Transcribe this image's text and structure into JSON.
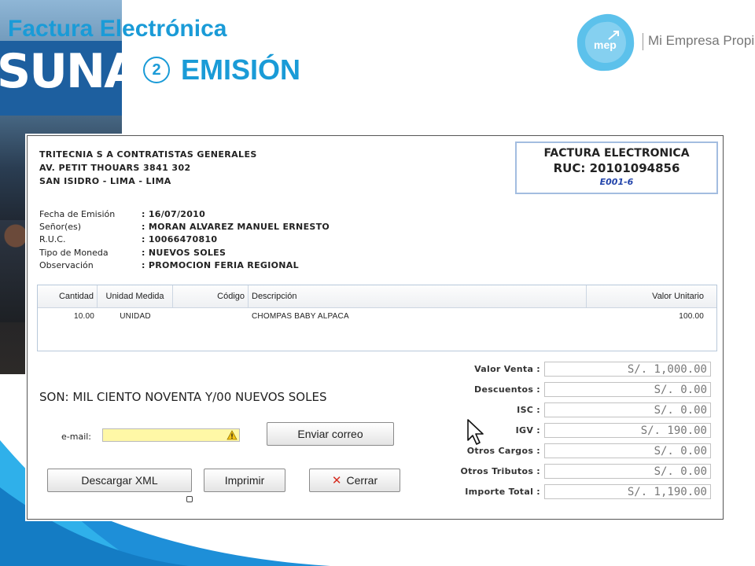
{
  "slide": {
    "title": "Factura Electrónica",
    "step_number": "2",
    "subtitle": "EMISIÓN",
    "photo_sign": "SUNAT"
  },
  "logo": {
    "brand": "mep",
    "text": "Mi Empresa Propia"
  },
  "invoice": {
    "company": {
      "name": "TRITECNIA S A CONTRATISTAS GENERALES",
      "address": "AV. PETIT THOUARS 3841 302",
      "district": "SAN ISIDRO - LIMA - LIMA"
    },
    "ruc_box": {
      "title": "FACTURA ELECTRONICA",
      "ruc": "RUC: 20101094856",
      "series": "E001-6"
    },
    "details": [
      {
        "label": "Fecha de Emisión",
        "value": ": 16/07/2010"
      },
      {
        "label": "Señor(es)",
        "value": ": MORAN ALVAREZ MANUEL ERNESTO"
      },
      {
        "label": "R.U.C.",
        "value": ": 10066470810"
      },
      {
        "label": "Tipo de Moneda",
        "value": ": NUEVOS SOLES"
      },
      {
        "label": "Observación",
        "value": ": PROMOCION FERIA REGIONAL"
      }
    ],
    "table": {
      "headers": [
        "Cantidad",
        "Unidad Medida",
        "Código",
        "Descripción",
        "Valor Unitario"
      ],
      "rows": [
        [
          "10.00",
          "UNIDAD",
          "",
          "CHOMPAS BABY ALPACA",
          "100.00"
        ]
      ]
    },
    "amount_words": "SON: MIL CIENTO NOVENTA Y/00 NUEVOS SOLES",
    "email": {
      "label": "e-mail:",
      "value": ""
    },
    "buttons": {
      "send_email": "Enviar correo",
      "download_xml": "Descargar XML",
      "print": "Imprimir",
      "close": "Cerrar"
    },
    "totals": [
      {
        "label": "Valor Venta :",
        "value": "S/. 1,000.00"
      },
      {
        "label": "Descuentos :",
        "value": "S/. 0.00"
      },
      {
        "label": "ISC :",
        "value": "S/. 0.00"
      },
      {
        "label": "IGV :",
        "value": "S/. 190.00"
      },
      {
        "label": "Otros Cargos :",
        "value": "S/. 0.00"
      },
      {
        "label": "Otros Tributos :",
        "value": "S/. 0.00"
      },
      {
        "label": "Importe Total :",
        "value": "S/. 1,190.00"
      }
    ]
  },
  "colors": {
    "accent": "#1a9bd7",
    "ruc_border": "#a3bde0",
    "email_bg": "#fff8a6"
  },
  "icons": [
    "warning-icon",
    "close-x-icon",
    "mouse-cursor-icon",
    "mep-logo-icon"
  ]
}
